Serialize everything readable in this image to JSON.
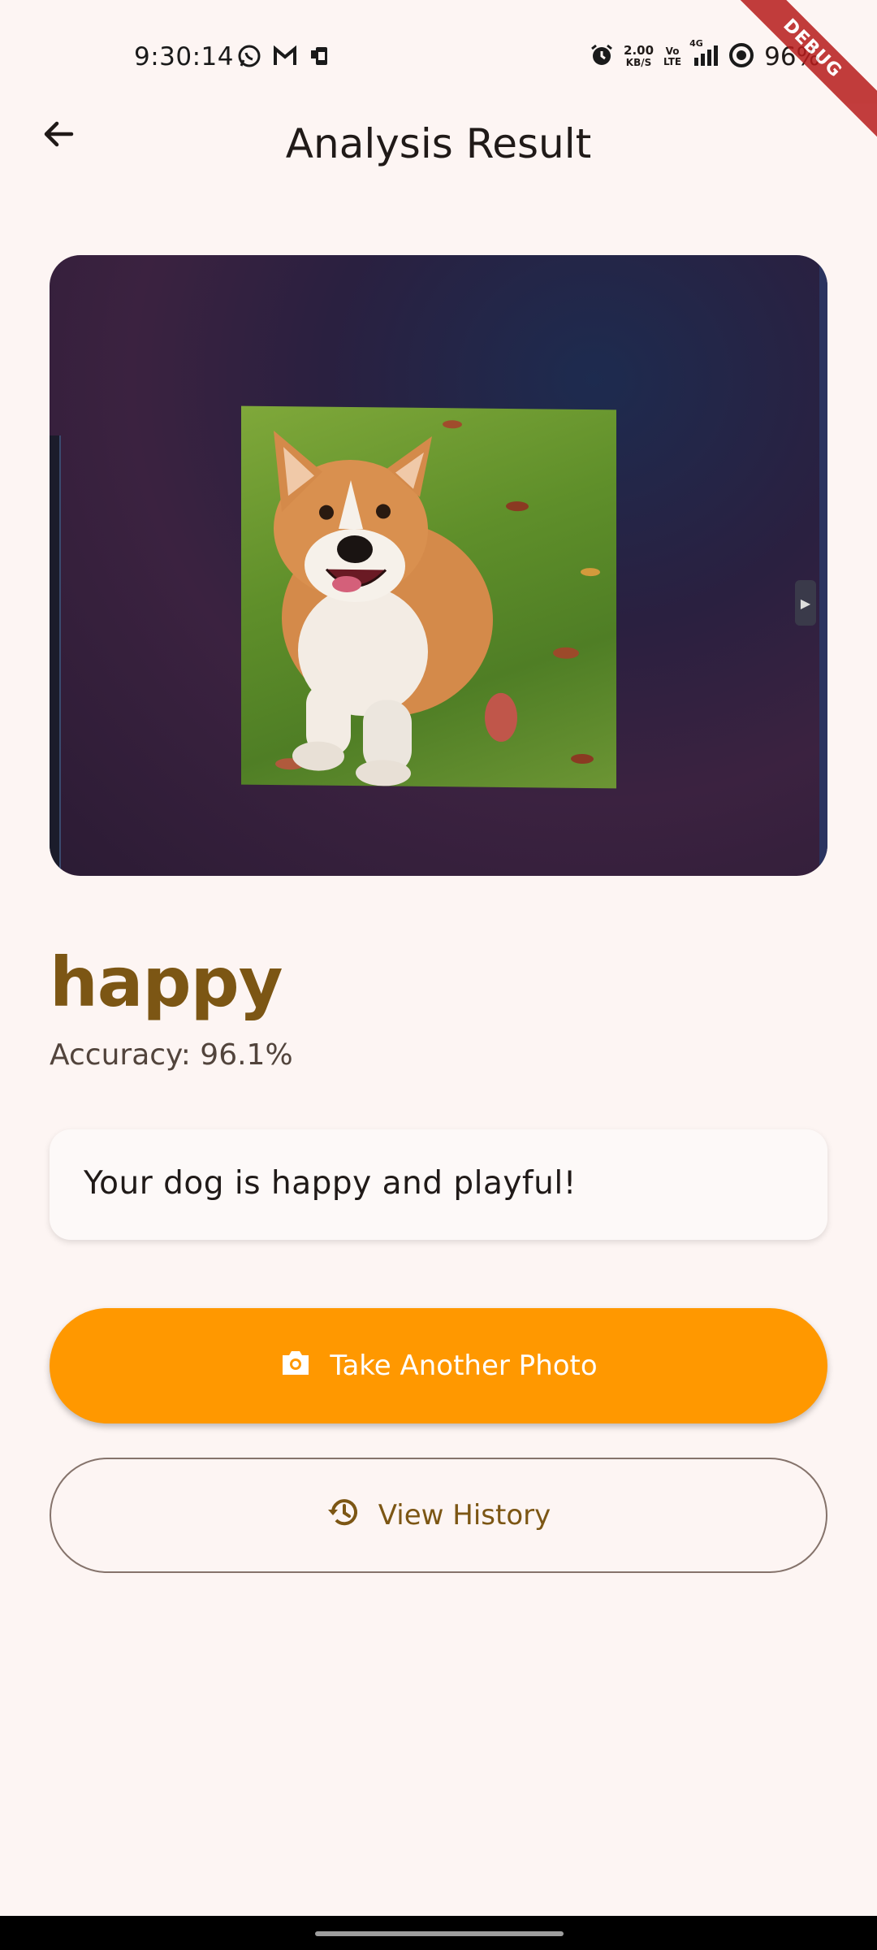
{
  "status_bar": {
    "time": "9:30:14",
    "net_speed_value": "2.00",
    "net_speed_unit": "KB/S",
    "volte_top": "Vo",
    "volte_bottom": "LTE",
    "network": "4G",
    "battery": "96%",
    "icons_left": [
      "whatsapp-icon",
      "gmail-icon",
      "phone-manager-icon"
    ],
    "icons_right": [
      "alarm-icon",
      "signal-icon",
      "focus-icon"
    ]
  },
  "debug_banner": "DEBUG",
  "app_bar": {
    "title": "Analysis Result",
    "back_icon": "arrow-back-icon"
  },
  "result": {
    "emotion": "happy",
    "accuracy": "Accuracy: 96.1%",
    "message": "Your dog is happy and playful!"
  },
  "actions": {
    "take_photo_label": "Take Another Photo",
    "take_photo_icon": "camera-icon",
    "view_history_label": "View History",
    "view_history_icon": "history-icon"
  },
  "colors": {
    "background": "#fdf5f3",
    "accent": "#ff9800",
    "emotion_text": "#7c5614"
  }
}
